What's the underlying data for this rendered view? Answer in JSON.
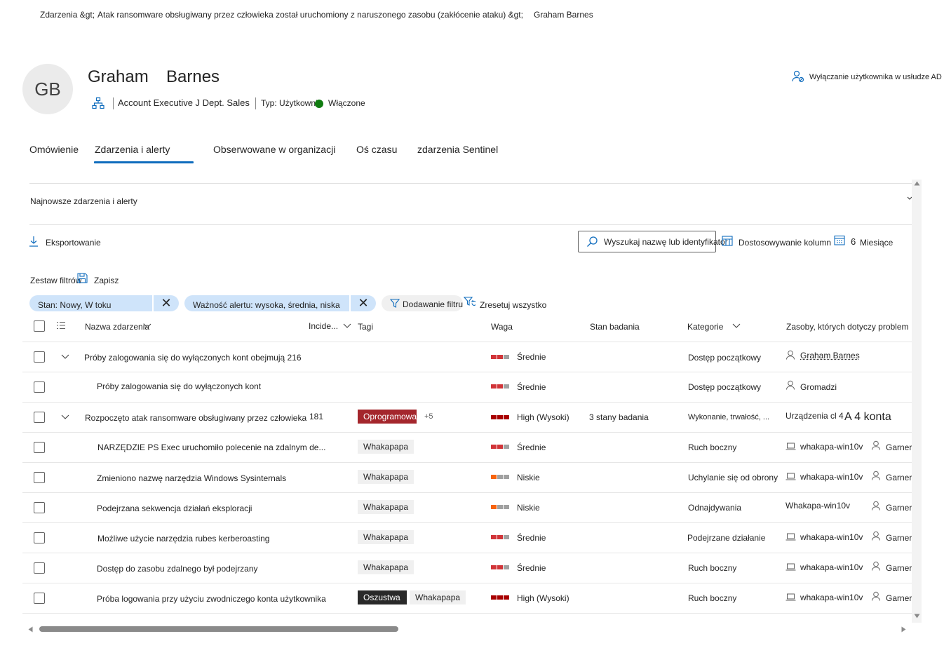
{
  "breadcrumb": {
    "part1": "Zdarzenia &gt;",
    "part2": "Atak ransomware obsługiwany przez człowieka został uruchomiony z naruszonego zasobu (zakłócenie ataku) &gt;",
    "part3": "Graham Barnes"
  },
  "user": {
    "initials": "GB",
    "first_name": "Graham",
    "last_name": "Barnes",
    "title": "Account Executive J Dept. Sales",
    "type": "Typ: Użytkownik",
    "status": "Włączone",
    "disable_action": "Wyłączanie użytkownika w usłudze AD"
  },
  "tabs": [
    {
      "label": "Omówienie"
    },
    {
      "label": "Zdarzenia i alerty"
    },
    {
      "label": "Obserwowane w organizacji"
    },
    {
      "label": "Oś czasu"
    },
    {
      "label": "zdarzenia Sentinel"
    }
  ],
  "section": {
    "title": "Najnowsze zdarzenia i alerty"
  },
  "toolbar": {
    "export": "Eksportowanie",
    "search_placeholder": "Wyszukaj nazwę lub identyfikator",
    "customize_columns": "Dostosowywanie kolumn",
    "period_number": "6",
    "period_unit": "Miesiące"
  },
  "filters": {
    "filter_set": "Zestaw filtrów",
    "save": "Zapisz",
    "chips": [
      {
        "label": "Stan: Nowy, W toku"
      },
      {
        "label": "Ważność alertu: wysoka, średnia, niska"
      }
    ],
    "add_filter": "Dodawanie filtru",
    "reset_all": "Zresetuj wszystko"
  },
  "table": {
    "headers": {
      "name": "Nazwa zdarzenia",
      "incident": "Incide...",
      "tags": "Tagi",
      "severity": "Waga",
      "investigation": "Stan badania",
      "category": "Kategorie",
      "assets": "Zasoby, których dotyczy problem"
    },
    "rows": [
      {
        "name": "Próby zalogowania się do wyłączonych kont obejmują 216",
        "severity": "Średnie",
        "category": "Dostęp początkowy",
        "asset1": "Graham Barnes"
      },
      {
        "name": "Próby zalogowania się do wyłączonych kont",
        "severity": "Średnie",
        "category": "Dostęp początkowy",
        "asset1": "Gromadzi"
      },
      {
        "name": "Rozpoczęto atak ransomware obsługiwany przez człowieka",
        "incident": "181",
        "tag1": "Oprogramowanie",
        "tag_more": "+5",
        "severity": "High (Wysoki)",
        "investigation": "3 stany badania",
        "category": "Wykonanie, trwałość, ...",
        "asset1": "Urządzenia cl 4",
        "asset2": "A 4 konta"
      },
      {
        "name": "NARZĘDZIE PS Exec uruchomiło polecenie na zdalnym de...",
        "tag1": "Whakapapa",
        "severity": "Średnie",
        "category": "Ruch boczny",
        "asset1": "whakapa-win10v",
        "asset2": "Garner"
      },
      {
        "name": "Zmieniono nazwę narzędzia Windows Sysinternals",
        "tag1": "Whakapapa",
        "severity": "Niskie",
        "category": "Uchylanie się od obrony",
        "asset1": "whakapa-win10v",
        "asset2": "Garner"
      },
      {
        "name": "Podejrzana sekwencja działań eksploracji",
        "tag1": "Whakapapa",
        "severity": "Niskie",
        "category": "Odnajdywania",
        "asset1": "Whakapa-win10v",
        "asset2": "Garner"
      },
      {
        "name": "Możliwe użycie narzędzia rubes kerberoasting",
        "tag1": "Whakapapa",
        "severity": "Średnie",
        "category": "Podejrzane działanie",
        "asset1": "whakapa-win10v",
        "asset2": "Garner"
      },
      {
        "name": "Dostęp do zasobu zdalnego był podejrzany",
        "tag1": "Whakapapa",
        "severity": "Średnie",
        "category": "Ruch boczny",
        "asset1": "whakapa-win10v",
        "asset2": "Garner"
      },
      {
        "name": "Próba logowania przy użyciu zwodniczego konta użytkownika",
        "tag1": "Oszustwa",
        "tag2": "Whakapapa",
        "severity": "High (Wysoki)",
        "category": "Ruch boczny",
        "asset1": "whakapa-win10v",
        "asset2": "Garner"
      }
    ]
  },
  "colors": {
    "accent": "#0f6cbd",
    "high": "#a80000",
    "medium": "#d13438",
    "low": "#f7630c",
    "chip": "#cfe4fa",
    "enabled": "#107c10"
  }
}
